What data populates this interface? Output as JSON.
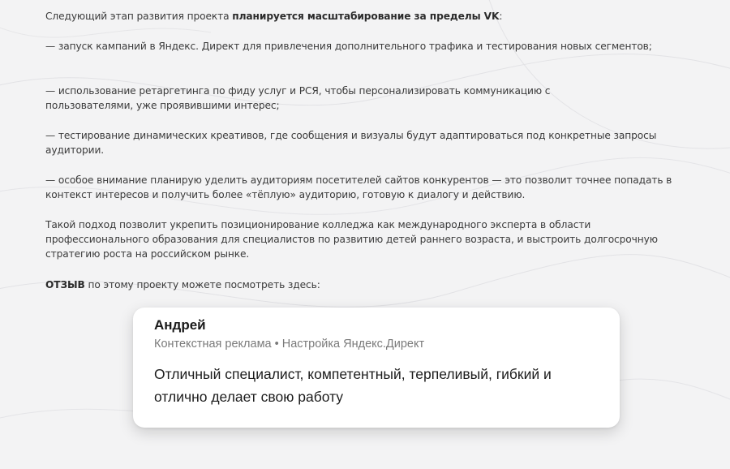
{
  "intro": {
    "lead": "Следующий этап развития проекта ",
    "bold": "планируется масштабирование за пределы VK",
    "tail": ":"
  },
  "bullets": [
    "— запуск кампаний в Яндекс. Директ для привлечения дополнительного трафика и тестирования новых сегментов;",
    "— использование ретаргетинга по фиду услуг и РСЯ, чтобы персонализировать коммуникацию с пользователями, уже проявившими интерес;",
    "— тестирование динамических креативов, где сообщения и визуалы будут адаптироваться под конкретные запросы аудитории.",
    "— особое внимание планирую уделить аудиториям посетителей сайтов конкурентов — это позволит точнее попадать в контекст интересов и получить более «тёплую» аудиторию, готовую к диалогу и действию."
  ],
  "conclusion": "Такой подход позволит укрепить позиционирование колледжа как международного эксперта в области профессионального образования для специалистов по развитию детей раннего возраста, и выстроить долгосрочную стратегию роста на российском рынке.",
  "review_link": {
    "bold": "ОТЗЫВ",
    "text": " по этому проекту можете посмотреть здесь:"
  },
  "review_card": {
    "name": "Андрей",
    "meta": "Контекстная реклама • Настройка Яндекс.Директ",
    "text": "Отличный специалист, компетентный, терпеливый, гибкий и отлично делает свою работу"
  }
}
